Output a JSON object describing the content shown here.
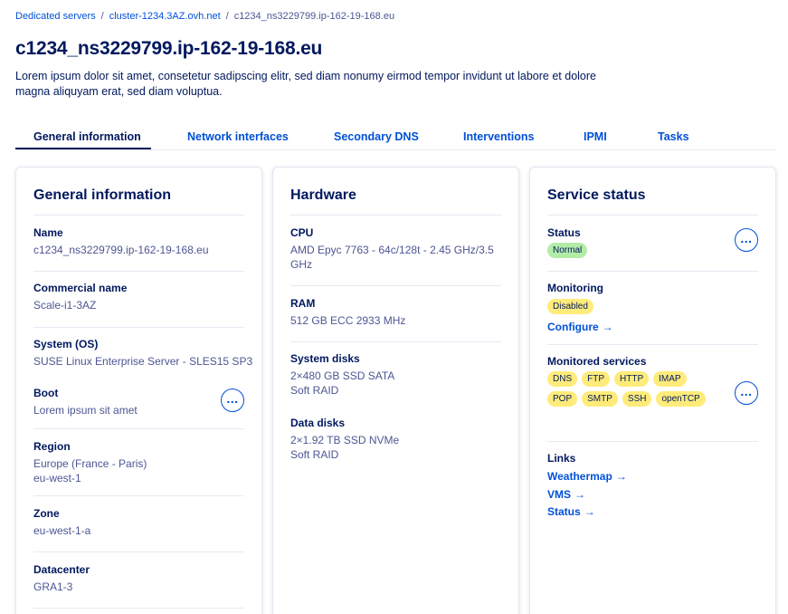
{
  "breadcrumb": {
    "items": [
      "Dedicated servers",
      "cluster-1234.3AZ.ovh.net"
    ],
    "separator": "/",
    "current": "c1234_ns3229799.ip-162-19-168.eu"
  },
  "page": {
    "title": "c1234_ns3229799.ip-162-19-168.eu",
    "description": "Lorem ipsum dolor sit amet, consetetur sadipscing elitr, sed diam nonumy eirmod tempor invidunt ut labore et dolore magna aliquyam erat, sed diam voluptua."
  },
  "tabs": [
    "General information",
    "Network interfaces",
    "Secondary DNS",
    "Interventions",
    "IPMI",
    "Tasks"
  ],
  "general": {
    "title": "General information",
    "name_label": "Name",
    "name_value": "c1234_ns3229799.ip-162-19-168.eu",
    "commercial_label": "Commercial name",
    "commercial_value": "Scale-i1-3AZ",
    "os_label": "System (OS)",
    "os_value": "SUSE Linux Enterprise Server - SLES15 SP3",
    "boot_label": "Boot",
    "boot_value": "Lorem ipsum sit amet",
    "region_label": "Region",
    "region_value_1": "Europe (France - Paris)",
    "region_value_2": "eu-west-1",
    "zone_label": "Zone",
    "zone_value": "eu-west-1-a",
    "datacenter_label": "Datacenter",
    "datacenter_value": "GRA1-3"
  },
  "hardware": {
    "title": "Hardware",
    "cpu_label": "CPU",
    "cpu_value_1": "AMD Epyc 7763 - 64c/128t - 2.45 GHz/3.5",
    "cpu_value_2": "GHz",
    "ram_label": "RAM",
    "ram_value": "512 GB ECC 2933 MHz",
    "system_disks_label": "System disks",
    "system_disks_value_1": "2×480 GB SSD SATA",
    "system_disks_value_2": "Soft RAID",
    "data_disks_label": "Data disks",
    "data_disks_value_1": "2×1.92 TB SSD NVMe",
    "data_disks_value_2": "Soft RAID"
  },
  "service": {
    "title": "Service status",
    "status_label": "Status",
    "status_badge": "Normal",
    "monitoring_label": "Monitoring",
    "monitoring_badge": "Disabled",
    "configure_link": "Configure",
    "monitored_label": "Monitored services",
    "monitored_badges": [
      "DNS",
      "FTP",
      "HTTP",
      "IMAP",
      "POP",
      "SMTP",
      "SSH",
      "openTCP"
    ],
    "links_label": "Links",
    "links": [
      "Weathermap",
      "VMS",
      "Status"
    ]
  },
  "icons": {
    "menu": "ellipsis-icon",
    "arrow": "arrow-right-icon"
  },
  "colors": {
    "primary_text": "#00185e",
    "link": "#0050d7",
    "muted_text": "#4d5693",
    "badge_success": "#b3eca7",
    "badge_warning": "#ffeb7a"
  }
}
